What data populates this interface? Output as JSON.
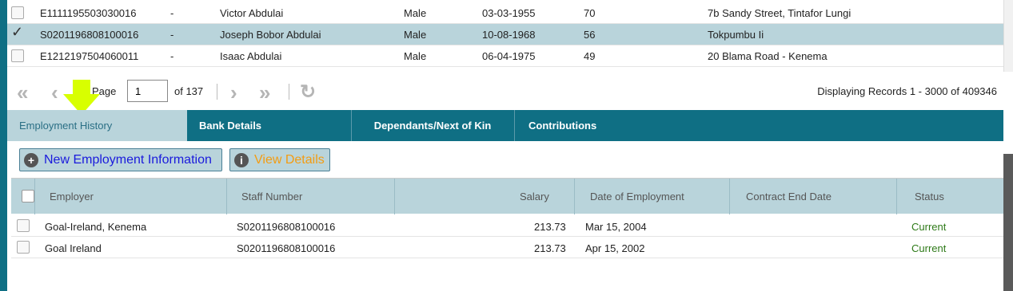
{
  "people": [
    {
      "id": "E1111195503030016",
      "dash": "-",
      "name": "Victor Abdulai",
      "gender": "Male",
      "dob": "03-03-1955",
      "age": "70",
      "address": "7b Sandy Street, Tintafor Lungi",
      "checked": false
    },
    {
      "id": "S0201196808100016",
      "dash": "-",
      "name": "Joseph Bobor Abdulai",
      "gender": "Male",
      "dob": "10-08-1968",
      "age": "56",
      "address": "Tokpumbu Ii",
      "checked": true
    },
    {
      "id": "E1212197504060011",
      "dash": "-",
      "name": "Isaac Abdulai",
      "gender": "Male",
      "dob": "06-04-1975",
      "age": "49",
      "address": "20 Blama Road - Kenema",
      "checked": false
    }
  ],
  "pager": {
    "page_label": "Page",
    "page_value": "1",
    "of_label": "of 137",
    "display_text": "Displaying Records 1 - 3000 of 409346"
  },
  "tabs": [
    "Employment History",
    "Bank Details",
    "Dependants/Next of Kin",
    "Contributions"
  ],
  "buttons": {
    "new_label": "New Employment Information",
    "view_label": "View Details"
  },
  "employment": {
    "headers": [
      "Employer",
      "Staff Number",
      "Salary",
      "Date of Employment",
      "Contract End Date",
      "Status"
    ],
    "rows": [
      {
        "employer": "Goal-Ireland, Kenema",
        "staff_number": "S0201196808100016",
        "salary": "213.73",
        "date": "Mar 15, 2004",
        "end": "",
        "status": "Current"
      },
      {
        "employer": "Goal Ireland",
        "staff_number": "S0201196808100016",
        "salary": "213.73",
        "date": "Apr 15, 2002",
        "end": "",
        "status": "Current"
      }
    ]
  },
  "colors": {
    "accent": "#0f6f84",
    "selected_row": "#b9d4db",
    "status_current": "#2e7a18",
    "view_details_text": "#f39c12",
    "new_button_text": "#1a1adc",
    "arrow": "#d8ff00"
  },
  "icons": [
    "first-page-icon",
    "prev-page-icon",
    "next-page-icon",
    "last-page-icon",
    "refresh-icon",
    "plus-circle-icon",
    "info-circle-icon",
    "checkmark-icon",
    "annotation-arrow-icon"
  ]
}
